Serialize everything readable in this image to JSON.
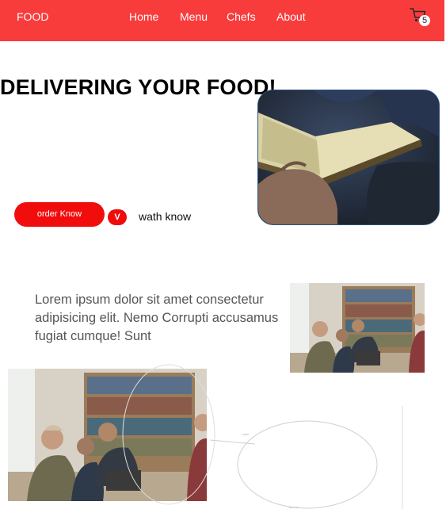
{
  "nav": {
    "brand": "FOOD",
    "links": [
      "Home",
      "Menu",
      "Chefs",
      "About"
    ],
    "cart_icon": "cart-icon",
    "cart_count": "5",
    "color": "#f83c3c"
  },
  "hero": {
    "title": "DELIVERING YOUR FOOD!",
    "image": "book-in-hands-photo",
    "order_button": "order Know",
    "badge": "V",
    "watch_link": "wath know",
    "accent": "#f20d0d"
  },
  "about": {
    "text": "Lorem ipsum dolor sit amet consectetur adipisicing elit. Nemo Corrupti accusamus fugiat cumque! Sunt",
    "image_small": "people-at-laptop-photo",
    "image_large": "people-at-laptop-photo"
  }
}
